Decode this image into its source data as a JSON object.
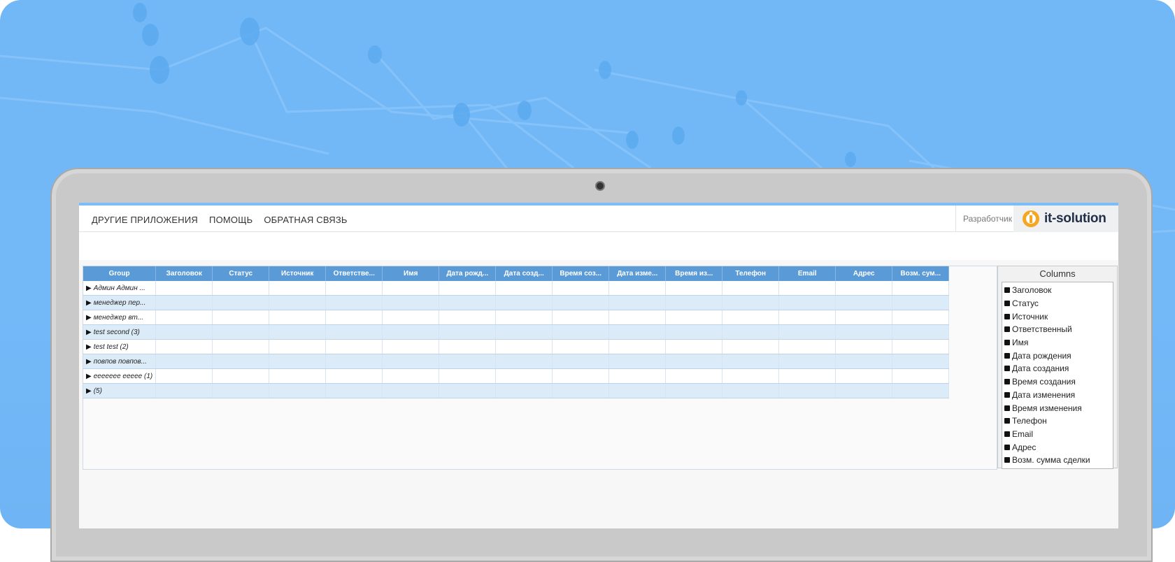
{
  "topbar": {
    "nav": [
      "ДРУГИЕ ПРИЛОЖЕНИЯ",
      "ПОМОЩЬ",
      "ОБРАТНАЯ СВЯЗЬ"
    ],
    "developer_label": "Разработчик",
    "logo_text": "it-solution"
  },
  "grid": {
    "headers": [
      "Group",
      "Заголовок",
      "Статус",
      "Источник",
      "Ответстве...",
      "Имя",
      "Дата рожд...",
      "Дата созд...",
      "Время соз...",
      "Дата изме...",
      "Время из...",
      "Телефон",
      "Email",
      "Адрес",
      "Возм. сум..."
    ],
    "rows": [
      "Админ Админ ...",
      "менеджер пер...",
      "менеджер вт...",
      "test second (3)",
      "test test (2)",
      "повпов повпов...",
      "еееееее ееееe (1)",
      "(5)"
    ]
  },
  "columns_panel": {
    "title": "Columns",
    "items": [
      "Заголовок",
      "Статус",
      "Источник",
      "Ответственный",
      "Имя",
      "Дата рождения",
      "Дата создания",
      "Время создания",
      "Дата изменения",
      "Время изменения",
      "Телефон",
      "Email",
      "Адрес",
      "Возм. сумма сделки"
    ]
  },
  "colors": {
    "background": "#72b8f6",
    "header": "#5a9ad6",
    "row_alt": "#dcebf8",
    "logo_accent": "#f5a623"
  }
}
